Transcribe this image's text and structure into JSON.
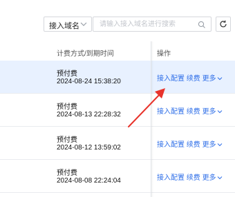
{
  "toolbar": {
    "select_label": "接入域名",
    "search_placeholder": "请输入接入域名进行搜索",
    "search_value": ""
  },
  "table": {
    "headers": {
      "billing": "计费方式/到期时间",
      "actions": "操作"
    },
    "rows": [
      {
        "billing": "预付费",
        "expire": "2024-08-24 15:38:20",
        "op_config": "接入配置",
        "op_renew": "续费",
        "op_more": "更多",
        "selected": true
      },
      {
        "billing": "预付费",
        "expire": "2024-08-13 22:28:32",
        "op_config": "接入配置",
        "op_renew": "续费",
        "op_more": "更多",
        "selected": false
      },
      {
        "billing": "预付费",
        "expire": "2024-08-12 13:59:02",
        "op_config": "接入配置",
        "op_renew": "续费",
        "op_more": "更多",
        "selected": false
      },
      {
        "billing": "预付费",
        "expire": "2024-08-08 22:24:04",
        "op_config": "接入配置",
        "op_renew": "续费",
        "op_more": "更多",
        "selected": false
      }
    ]
  },
  "colors": {
    "link": "#2f6fe8",
    "selected_row": "#e8f1ff",
    "annotation_arrow": "#e8332b"
  },
  "icons": {
    "select_chevron": "chevron-down-icon",
    "search": "search-icon",
    "refresh": "refresh-icon",
    "more_chevron": "chevron-down-icon",
    "annotation": "red-arrow-icon"
  }
}
